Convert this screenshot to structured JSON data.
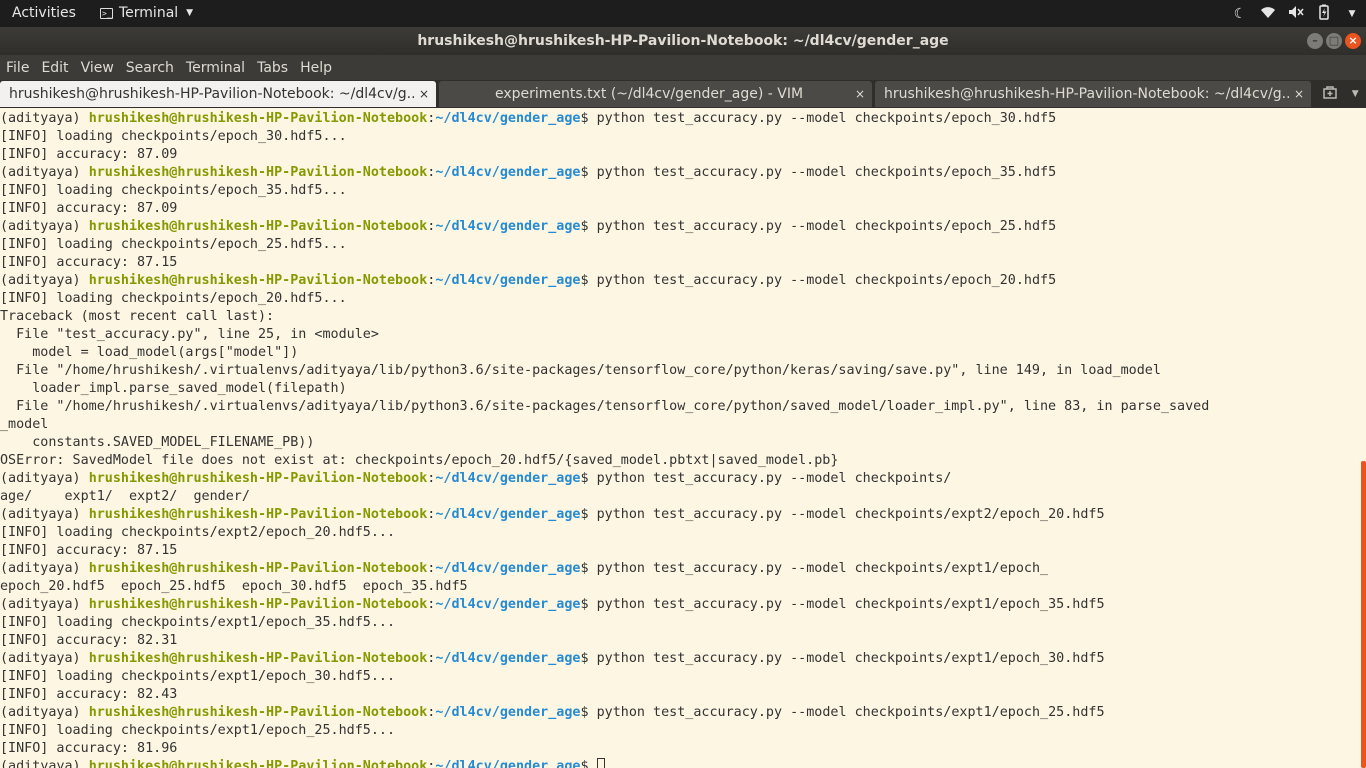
{
  "topbar": {
    "activities": "Activities",
    "app_name": "Terminal"
  },
  "window": {
    "title": "hrushikesh@hrushikesh-HP-Pavilion-Notebook: ~/dl4cv/gender_age"
  },
  "menu": [
    "File",
    "Edit",
    "View",
    "Search",
    "Terminal",
    "Tabs",
    "Help"
  ],
  "tabs": [
    {
      "label": "hrushikesh@hrushikesh-HP-Pavilion-Notebook: ~/dl4cv/g...",
      "close": "×"
    },
    {
      "label": "experiments.txt (~/dl4cv/gender_age) - VIM",
      "close": "×"
    },
    {
      "label": "hrushikesh@hrushikesh-HP-Pavilion-Notebook: ~/dl4cv/g...",
      "close": "×"
    }
  ],
  "prompt": {
    "env": "(adityaya) ",
    "user": "hrushikesh@hrushikesh-HP-Pavilion-Notebook",
    "sep": ":",
    "path": "~/dl4cv/gender_age",
    "dollar": "$ "
  },
  "lines": [
    {
      "type": "prompt",
      "cmd": "python test_accuracy.py --model checkpoints/epoch_30.hdf5"
    },
    {
      "type": "out",
      "text": "[INFO] loading checkpoints/epoch_30.hdf5..."
    },
    {
      "type": "out",
      "text": "[INFO] accuracy: 87.09"
    },
    {
      "type": "prompt",
      "cmd": "python test_accuracy.py --model checkpoints/epoch_35.hdf5"
    },
    {
      "type": "out",
      "text": "[INFO] loading checkpoints/epoch_35.hdf5..."
    },
    {
      "type": "out",
      "text": "[INFO] accuracy: 87.09"
    },
    {
      "type": "prompt",
      "cmd": "python test_accuracy.py --model checkpoints/epoch_25.hdf5"
    },
    {
      "type": "out",
      "text": "[INFO] loading checkpoints/epoch_25.hdf5..."
    },
    {
      "type": "out",
      "text": "[INFO] accuracy: 87.15"
    },
    {
      "type": "prompt",
      "cmd": "python test_accuracy.py --model checkpoints/epoch_20.hdf5"
    },
    {
      "type": "out",
      "text": "[INFO] loading checkpoints/epoch_20.hdf5..."
    },
    {
      "type": "out",
      "text": "Traceback (most recent call last):"
    },
    {
      "type": "out",
      "text": "  File \"test_accuracy.py\", line 25, in <module>"
    },
    {
      "type": "out",
      "text": "    model = load_model(args[\"model\"])"
    },
    {
      "type": "out",
      "text": "  File \"/home/hrushikesh/.virtualenvs/adityaya/lib/python3.6/site-packages/tensorflow_core/python/keras/saving/save.py\", line 149, in load_model"
    },
    {
      "type": "out",
      "text": "    loader_impl.parse_saved_model(filepath)"
    },
    {
      "type": "out",
      "text": "  File \"/home/hrushikesh/.virtualenvs/adityaya/lib/python3.6/site-packages/tensorflow_core/python/saved_model/loader_impl.py\", line 83, in parse_saved"
    },
    {
      "type": "out",
      "text": "_model"
    },
    {
      "type": "out",
      "text": "    constants.SAVED_MODEL_FILENAME_PB))"
    },
    {
      "type": "out",
      "text": "OSError: SavedModel file does not exist at: checkpoints/epoch_20.hdf5/{saved_model.pbtxt|saved_model.pb}"
    },
    {
      "type": "prompt",
      "cmd": "python test_accuracy.py --model checkpoints/"
    },
    {
      "type": "out",
      "text": "age/    expt1/  expt2/  gender/"
    },
    {
      "type": "prompt",
      "cmd": "python test_accuracy.py --model checkpoints/expt2/epoch_20.hdf5"
    },
    {
      "type": "out",
      "text": "[INFO] loading checkpoints/expt2/epoch_20.hdf5..."
    },
    {
      "type": "out",
      "text": "[INFO] accuracy: 87.15"
    },
    {
      "type": "prompt",
      "cmd": "python test_accuracy.py --model checkpoints/expt1/epoch_"
    },
    {
      "type": "out",
      "text": "epoch_20.hdf5  epoch_25.hdf5  epoch_30.hdf5  epoch_35.hdf5"
    },
    {
      "type": "prompt",
      "cmd": "python test_accuracy.py --model checkpoints/expt1/epoch_35.hdf5"
    },
    {
      "type": "out",
      "text": "[INFO] loading checkpoints/expt1/epoch_35.hdf5..."
    },
    {
      "type": "out",
      "text": "[INFO] accuracy: 82.31"
    },
    {
      "type": "prompt",
      "cmd": "python test_accuracy.py --model checkpoints/expt1/epoch_30.hdf5"
    },
    {
      "type": "out",
      "text": "[INFO] loading checkpoints/expt1/epoch_30.hdf5..."
    },
    {
      "type": "out",
      "text": "[INFO] accuracy: 82.43"
    },
    {
      "type": "prompt",
      "cmd": "python test_accuracy.py --model checkpoints/expt1/epoch_25.hdf5"
    },
    {
      "type": "out",
      "text": "[INFO] loading checkpoints/expt1/epoch_25.hdf5..."
    },
    {
      "type": "out",
      "text": "[INFO] accuracy: 81.96"
    },
    {
      "type": "prompt",
      "cmd": "",
      "cursor": true
    }
  ]
}
